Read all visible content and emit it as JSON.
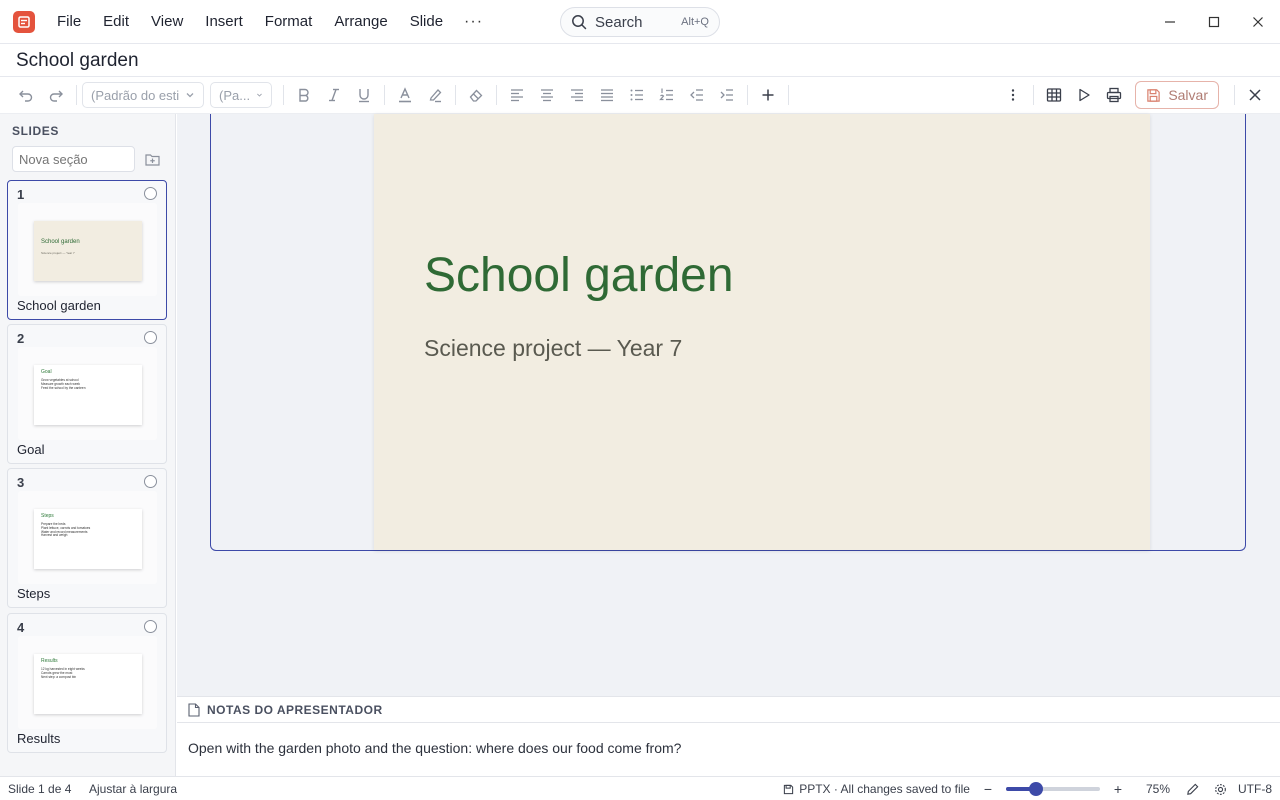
{
  "menubar": {
    "items": [
      "File",
      "Edit",
      "View",
      "Insert",
      "Format",
      "Arrange",
      "Slide"
    ],
    "more": "···",
    "search_label": "Search",
    "search_shortcut": "Alt+Q"
  },
  "document": {
    "title": "School garden"
  },
  "toolbar": {
    "style_select": "(Padrão do estil...",
    "size_select": "(Pa...",
    "save_label": "Salvar"
  },
  "sidebar": {
    "heading": "SLIDES",
    "section_placeholder": "Nova seção",
    "slides": [
      {
        "num": "1",
        "label": "School garden",
        "thumb_title": "School garden",
        "thumb_sub": "Science project — Year 7"
      },
      {
        "num": "2",
        "label": "Goal",
        "thumb_title": "Goal",
        "thumb_lines": [
          "Grow vegetables at school",
          "Measure growth each week",
          "Feed the school by the canteen"
        ]
      },
      {
        "num": "3",
        "label": "Steps",
        "thumb_title": "Steps",
        "thumb_lines": [
          "Prepare the beds",
          "Plant lettuce, carrots and tomatoes",
          "Water and record measurements",
          "Harvest and weigh"
        ]
      },
      {
        "num": "4",
        "label": "Results",
        "thumb_title": "Results",
        "thumb_lines": [
          "12 kg harvested in eight weeks",
          "Carrots grew the most",
          "Next step: a compost bin"
        ]
      }
    ]
  },
  "slide": {
    "title": "School garden",
    "subtitle": "Science project — Year 7"
  },
  "notes": {
    "heading": "NOTAS DO APRESENTADOR",
    "text": "Open with the garden photo and the question: where does our food come from?"
  },
  "status": {
    "slide_counter": "Slide 1 de 4",
    "fit": "Ajustar à largura",
    "file_status": "PPTX · All changes saved to file",
    "zoom_minus": "−",
    "zoom_plus": "+",
    "zoom": "75%",
    "zoom_fraction": 0.32,
    "encoding": "UTF-8"
  },
  "colors": {
    "accent": "#3d4aa8",
    "app_logo": "#e4533d",
    "slide_background": "#f2ede1",
    "slide_title": "#2f6a35"
  }
}
